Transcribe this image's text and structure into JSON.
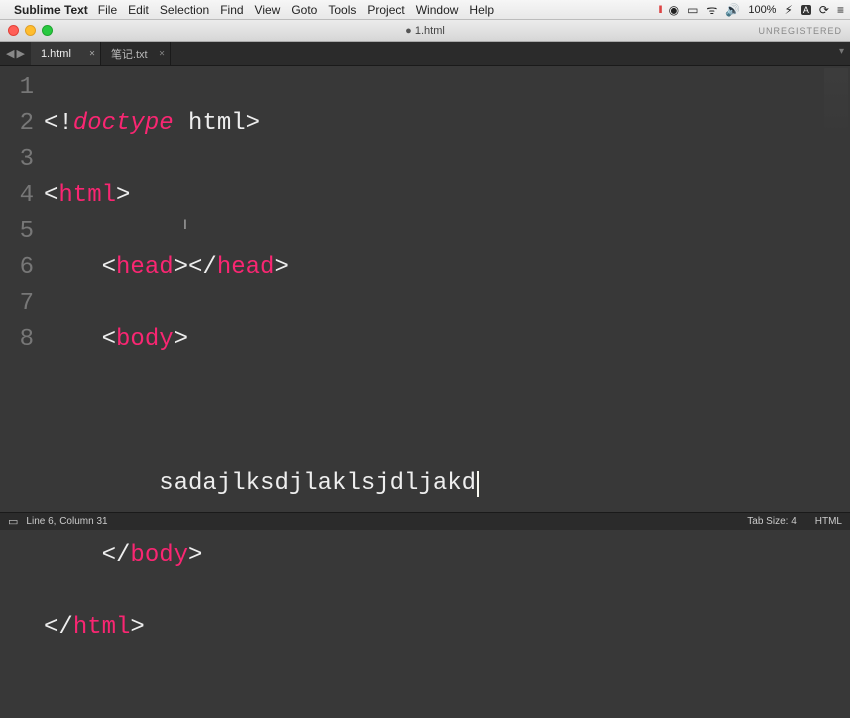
{
  "menubar": {
    "app": "Sublime Text",
    "items": [
      "File",
      "Edit",
      "Selection",
      "Find",
      "View",
      "Goto",
      "Tools",
      "Project",
      "Window",
      "Help"
    ],
    "right": {
      "battery": "100%",
      "battery_icon": "⚡︎"
    }
  },
  "window": {
    "title": "1.html",
    "dirty_marker": "●",
    "unregistered": "UNREGISTERED"
  },
  "tabs": [
    {
      "label": "1.html",
      "active": true
    },
    {
      "label": "笔记.txt",
      "active": false
    }
  ],
  "code": {
    "line1_lt": "<!",
    "line1_doctype": "doctype",
    "line1_sp": " ",
    "line1_html": "html",
    "line1_gt": ">",
    "line2_lt": "<",
    "line2_tag": "html",
    "line2_gt": ">",
    "line3_indent": "    ",
    "line3_lt1": "<",
    "line3_head": "head",
    "line3_gt1": ">",
    "line3_lt2": "</",
    "line3_gt2": ">",
    "line4_indent": "    ",
    "line4_lt": "<",
    "line4_body": "body",
    "line4_gt": ">",
    "line5_indent": "        ",
    "line6_indent": "        ",
    "line6_text": "sadajlksdjlaklsjdljakd",
    "line7_indent": "    ",
    "line7_lt": "</",
    "line7_gt": ">",
    "line8_lt": "</",
    "line8_gt": ">"
  },
  "gutter": [
    "1",
    "2",
    "3",
    "4",
    "5",
    "6",
    "7",
    "8"
  ],
  "status": {
    "pos": "Line 6, Column 31",
    "tabsize": "Tab Size: 4",
    "syntax": "HTML"
  }
}
